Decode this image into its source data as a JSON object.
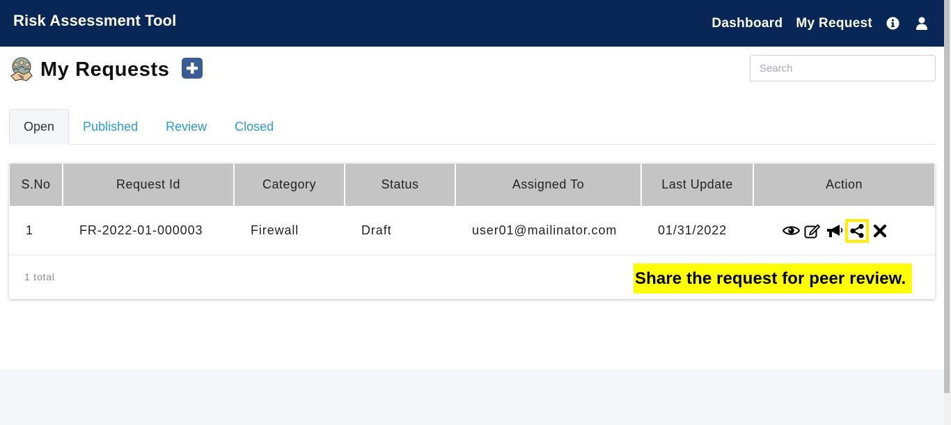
{
  "navbar": {
    "brand": "Risk Assessment Tool",
    "links": [
      "Dashboard",
      "My Request"
    ],
    "icons": [
      "info-icon",
      "user-icon"
    ]
  },
  "page": {
    "title": "My Requests",
    "logo_icon": "handshake-people-icon",
    "add_icon": "plus-square-icon"
  },
  "search": {
    "placeholder": "Search",
    "value": ""
  },
  "tabs": [
    {
      "label": "Open",
      "active": true
    },
    {
      "label": "Published",
      "active": false
    },
    {
      "label": "Review",
      "active": false
    },
    {
      "label": "Closed",
      "active": false
    }
  ],
  "table": {
    "columns": [
      "S.No",
      "Request Id",
      "Category",
      "Status",
      "Assigned To",
      "Last Update",
      "Action"
    ],
    "rows": [
      {
        "sno": "1",
        "request_id": "FR-2022-01-000003",
        "category": "Firewall",
        "status": "Draft",
        "assigned_to": "user01@mailinator.com",
        "last_update": "01/31/2022",
        "actions": [
          "eye-icon",
          "edit-icon",
          "megaphone-icon",
          "share-icon",
          "close-icon"
        ]
      }
    ],
    "total_text": "1 total"
  },
  "callout": {
    "text": "Share the request for peer review."
  },
  "colors": {
    "navbar": "#082756",
    "tab_link": "#2b9bd6",
    "table_header": "#c4c4c4",
    "highlight": "#ffee00",
    "callout_bg": "#ffff00",
    "add_button": "#3b5b96"
  }
}
